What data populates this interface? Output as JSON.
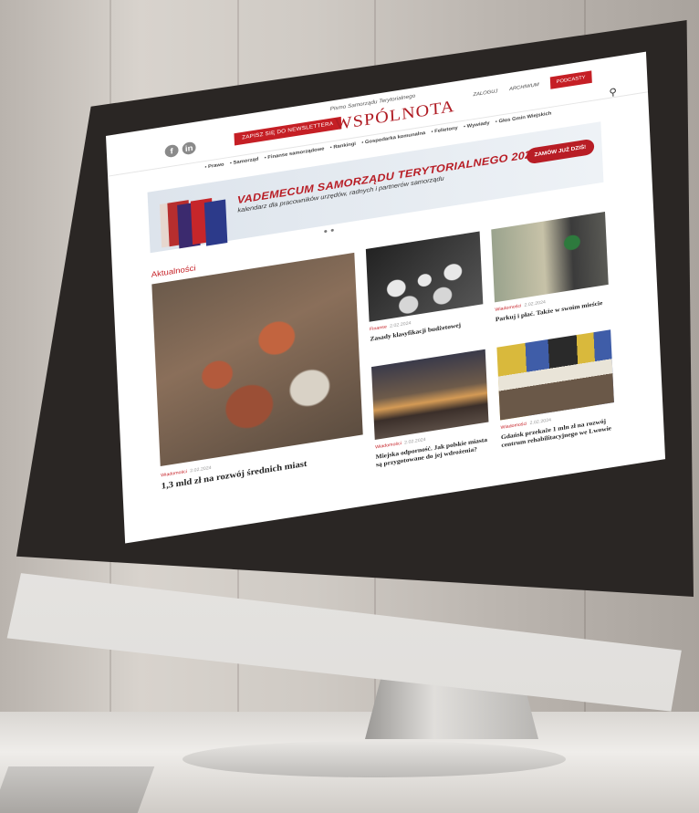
{
  "site": {
    "tagline": "Pismo Samorządu Terytorialnego",
    "logo": "WSPÓLNOTA",
    "subscribe_label": "ZAPISZ SIĘ DO NEWSLETTERA",
    "social": [
      "f",
      "in"
    ],
    "top_links": [
      "ZALOGUJ",
      "ARCHIWUM"
    ],
    "podcast_label": "PODCASTY",
    "search_icon": "search-icon"
  },
  "nav": [
    "Prawo",
    "Samorząd",
    "Finanse samorządowe",
    "Rankingi",
    "Gospodarka komunalna",
    "Felietony",
    "Wywiady",
    "Głos Gmin Wiejskich"
  ],
  "banner": {
    "title": "VADEMECUM SAMORZĄDU TERYTORIALNEGO 2024",
    "subtitle": "kalendarz dla pracowników urzędów, radnych i partnerów samorządu",
    "cta": "ZAMÓW JUŻ DZIŚ!"
  },
  "section_title": "Aktualności",
  "articles": [
    {
      "category": "Wiadomości",
      "date": "2.02.2024",
      "title": "1,3 mld zł na rozwój średnich miast"
    },
    {
      "category": "Finanse",
      "date": "2.02.2024",
      "title": "Zasady klasyfikacji budżetowej"
    },
    {
      "category": "Wiadomości",
      "date": "2.02.2024",
      "title": "Parkuj i płać. Także w swoim mieście"
    },
    {
      "category": "Wiadomości",
      "date": "2.02.2024",
      "title": "Miejska odporność. Jak polskie miasta są przygotowane do jej wdrożenia?"
    },
    {
      "category": "Wiadomości",
      "date": "2.02.2024",
      "title": "Gdańsk przekaże 1 mln zł na rozwój centrum rehabilitacyjnego we Lwowie"
    }
  ],
  "colors": {
    "brand_red": "#c51f25"
  }
}
